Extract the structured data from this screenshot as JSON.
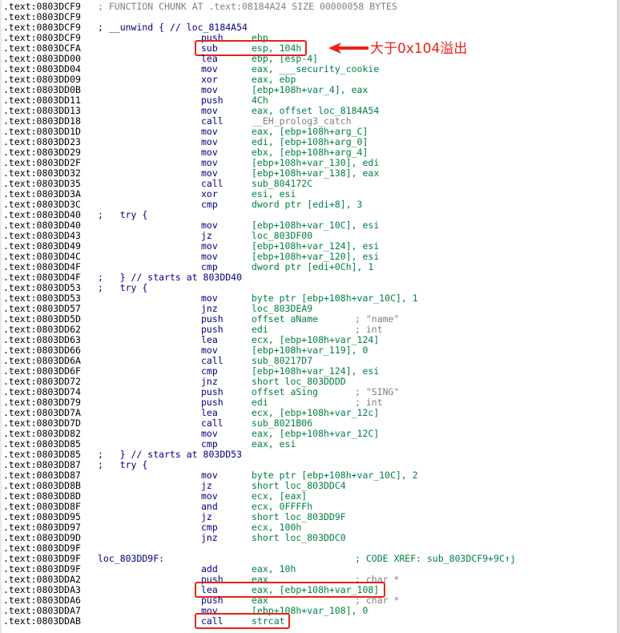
{
  "annotation": {
    "callout_text": "大于0x104溢出",
    "color": "#e8221a"
  },
  "colors": {
    "address": "#000000",
    "mnemonic": "#000080",
    "operand": "#008040",
    "comment": "#808080"
  },
  "lines": [
    {
      "addr": ".text:0803DCF9",
      "comment": "; FUNCTION CHUNK AT .text:08184A24 SIZE 00000058 BYTES"
    },
    {
      "addr": ".text:0803DCF9"
    },
    {
      "addr": ".text:0803DCF9",
      "label": "; __unwind { // loc_8184A54",
      "label_color": "blue"
    },
    {
      "addr": ".text:0803DCF9",
      "mn": "push",
      "op": "ebp"
    },
    {
      "addr": ".text:0803DCFA",
      "mn": "sub",
      "op": "esp, 104h",
      "boxed": true
    },
    {
      "addr": ".text:0803DD00",
      "mn": "lea",
      "op": "ebp, [esp-4]"
    },
    {
      "addr": ".text:0803DD04",
      "mn": "mov",
      "op": "eax, ___security_cookie"
    },
    {
      "addr": ".text:0803DD09",
      "mn": "xor",
      "op": "eax, ebp"
    },
    {
      "addr": ".text:0803DD0B",
      "mn": "mov",
      "op": "[ebp+108h+var_4], eax"
    },
    {
      "addr": ".text:0803DD11",
      "mn": "push",
      "op": "4Ch"
    },
    {
      "addr": ".text:0803DD13",
      "mn": "mov",
      "op": "eax, offset loc_8184A54"
    },
    {
      "addr": ".text:0803DD18",
      "mn": "call",
      "op": "__EH_prolog3_catch",
      "op_color": "gray"
    },
    {
      "addr": ".text:0803DD1D",
      "mn": "mov",
      "op": "eax, [ebp+108h+arg_C]"
    },
    {
      "addr": ".text:0803DD23",
      "mn": "mov",
      "op": "edi, [ebp+108h+arg_0]"
    },
    {
      "addr": ".text:0803DD29",
      "mn": "mov",
      "op": "ebx, [ebp+108h+arg_4]"
    },
    {
      "addr": ".text:0803DD2F",
      "mn": "mov",
      "op": "[ebp+108h+var_130], edi"
    },
    {
      "addr": ".text:0803DD32",
      "mn": "mov",
      "op": "[ebp+108h+var_138], eax"
    },
    {
      "addr": ".text:0803DD35",
      "mn": "call",
      "op": "sub_804172C"
    },
    {
      "addr": ".text:0803DD3A",
      "mn": "xor",
      "op": "esi, esi"
    },
    {
      "addr": ".text:0803DD3C",
      "mn": "cmp",
      "op": "dword ptr [edi+8], 3"
    },
    {
      "addr": ".text:0803DD40",
      "label": ";   try {",
      "label_color": "blue"
    },
    {
      "addr": ".text:0803DD40",
      "mn": "mov",
      "op": "[ebp+108h+var_10C], esi"
    },
    {
      "addr": ".text:0803DD43",
      "mn": "jz",
      "op": "loc_803DF00"
    },
    {
      "addr": ".text:0803DD49",
      "mn": "mov",
      "op": "[ebp+108h+var_124], esi"
    },
    {
      "addr": ".text:0803DD4C",
      "mn": "mov",
      "op": "[ebp+108h+var_120], esi"
    },
    {
      "addr": ".text:0803DD4F",
      "mn": "cmp",
      "op": "dword ptr [edi+0Ch], 1"
    },
    {
      "addr": ".text:0803DD4F",
      "label": ";   } // starts at 803DD40",
      "label_color": "blue"
    },
    {
      "addr": ".text:0803DD53",
      "label": ";   try {",
      "label_color": "blue"
    },
    {
      "addr": ".text:0803DD53",
      "mn": "mov",
      "op": "byte ptr [ebp+108h+var_10C], 1"
    },
    {
      "addr": ".text:0803DD57",
      "mn": "jnz",
      "op": "loc_803DEA9"
    },
    {
      "addr": ".text:0803DD5D",
      "mn": "push",
      "op": "offset aName",
      "comment": "; \"name\""
    },
    {
      "addr": ".text:0803DD62",
      "mn": "push",
      "op": "edi",
      "comment": "; int"
    },
    {
      "addr": ".text:0803DD63",
      "mn": "lea",
      "op": "ecx, [ebp+108h+var_124]"
    },
    {
      "addr": ".text:0803DD66",
      "mn": "mov",
      "op": "[ebp+108h+var_119], 0"
    },
    {
      "addr": ".text:0803DD6A",
      "mn": "call",
      "op": "sub_80217D7"
    },
    {
      "addr": ".text:0803DD6F",
      "mn": "cmp",
      "op": "[ebp+108h+var_124], esi"
    },
    {
      "addr": ".text:0803DD72",
      "mn": "jnz",
      "op": "short loc_803DDDD"
    },
    {
      "addr": ".text:0803DD74",
      "mn": "push",
      "op": "offset aSing",
      "comment": "; \"SING\""
    },
    {
      "addr": ".text:0803DD79",
      "mn": "push",
      "op": "edi",
      "comment": "; int"
    },
    {
      "addr": ".text:0803DD7A",
      "mn": "lea",
      "op": "ecx, [ebp+108h+var_12c]"
    },
    {
      "addr": ".text:0803DD7D",
      "mn": "call",
      "op": "sub_8021B06"
    },
    {
      "addr": ".text:0803DD82",
      "mn": "mov",
      "op": "eax, [ebp+108h+var_12C]"
    },
    {
      "addr": ".text:0803DD85",
      "mn": "cmp",
      "op": "eax, esi"
    },
    {
      "addr": ".text:0803DD85",
      "label": ";   } // starts at 803DD53",
      "label_color": "blue"
    },
    {
      "addr": ".text:0803DD87",
      "label": ";   try {",
      "label_color": "blue"
    },
    {
      "addr": ".text:0803DD87",
      "mn": "mov",
      "op": "byte ptr [ebp+108h+var_10C], 2"
    },
    {
      "addr": ".text:0803DD8B",
      "mn": "jz",
      "op": "short loc_803DDC4"
    },
    {
      "addr": ".text:0803DD8D",
      "mn": "mov",
      "op": "ecx, [eax]"
    },
    {
      "addr": ".text:0803DD8F",
      "mn": "and",
      "op": "ecx, 0FFFFh"
    },
    {
      "addr": ".text:0803DD95",
      "mn": "jz",
      "op": "short loc_803DD9F"
    },
    {
      "addr": ".text:0803DD97",
      "mn": "cmp",
      "op": "ecx, 100h"
    },
    {
      "addr": ".text:0803DD9D",
      "mn": "jnz",
      "op": "short loc_803DDC0"
    },
    {
      "addr": ".text:0803DD9F"
    },
    {
      "addr": ".text:0803DD9F",
      "label": "loc_803DD9F:",
      "label_color": "blue",
      "comment": "; CODE XREF: sub_803DCF9+9C↑j",
      "comment_color": "green"
    },
    {
      "addr": ".text:0803DD9F",
      "mn": "add",
      "op": "eax, 10h"
    },
    {
      "addr": ".text:0803DDA2",
      "mn": "push",
      "op": "eax",
      "comment": "; char *"
    },
    {
      "addr": ".text:0803DDA3",
      "mn": "lea",
      "op": "eax, [ebp+108h+var_108]",
      "boxed": true
    },
    {
      "addr": ".text:0803DDA6",
      "mn": "push",
      "op": "eax",
      "comment": "; char *"
    },
    {
      "addr": ".text:0803DDA7",
      "mn": "mov",
      "op": "[ebp+108h+var_108], 0"
    },
    {
      "addr": ".text:0803DDAB",
      "mn": "call",
      "op": "strcat",
      "boxed": true
    }
  ]
}
